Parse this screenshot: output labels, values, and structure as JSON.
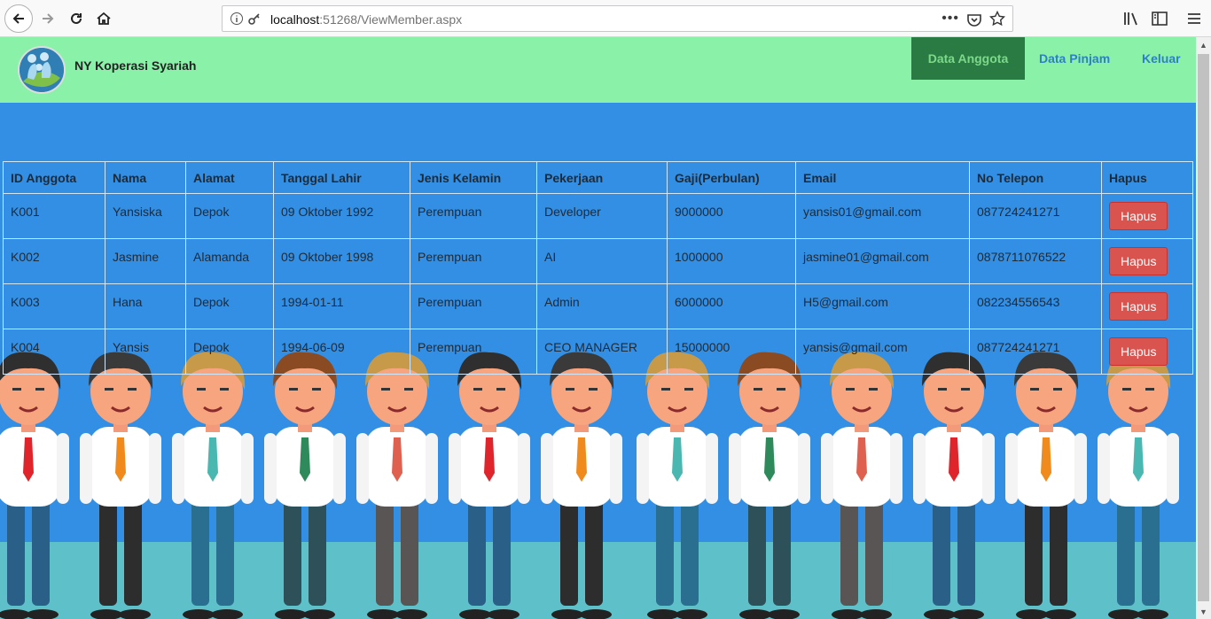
{
  "browser": {
    "url_host": "localhost",
    "url_path": ":51268/ViewMember.aspx",
    "page_actions": "•••"
  },
  "navbar": {
    "brand": "NY Koperasi Syariah",
    "links": [
      "Data Anggota",
      "Data Pinjam",
      "Keluar"
    ],
    "active_color": "#2a7a43",
    "bg_color": "#8af2a8"
  },
  "table": {
    "headers": [
      "ID Anggota",
      "Nama",
      "Alamat",
      "Tanggal Lahir",
      "Jenis Kelamin",
      "Pekerjaan",
      "Gaji(Perbulan)",
      "Email",
      "No Telepon",
      "Hapus"
    ],
    "rows": [
      [
        "K001",
        "Yansiska",
        "Depok",
        "09 Oktober 1992",
        "Perempuan",
        "Developer",
        "9000000",
        "yansis01@gmail.com",
        "087724241271"
      ],
      [
        "K002",
        "Jasmine",
        "Alamanda",
        "09 Oktober 1998",
        "Perempuan",
        "AI",
        "1000000",
        "jasmine01@gmail.com",
        "0878711076522"
      ],
      [
        "K003",
        "Hana",
        "Depok",
        "1994-01-11",
        "Perempuan",
        "Admin",
        "6000000",
        "H5@gmail.com",
        "082234556543"
      ],
      [
        "K004",
        "Yansis",
        "Depok",
        "1994-06-09",
        "Perempuan",
        "CEO MANAGER",
        "15000000",
        "yansis@gmail.com",
        "087724241271"
      ]
    ],
    "delete_label": "Hapus",
    "delete_color": "#d9534f"
  },
  "theme": {
    "page_bg": "#338fe4",
    "ground": "#5ec0c8"
  }
}
